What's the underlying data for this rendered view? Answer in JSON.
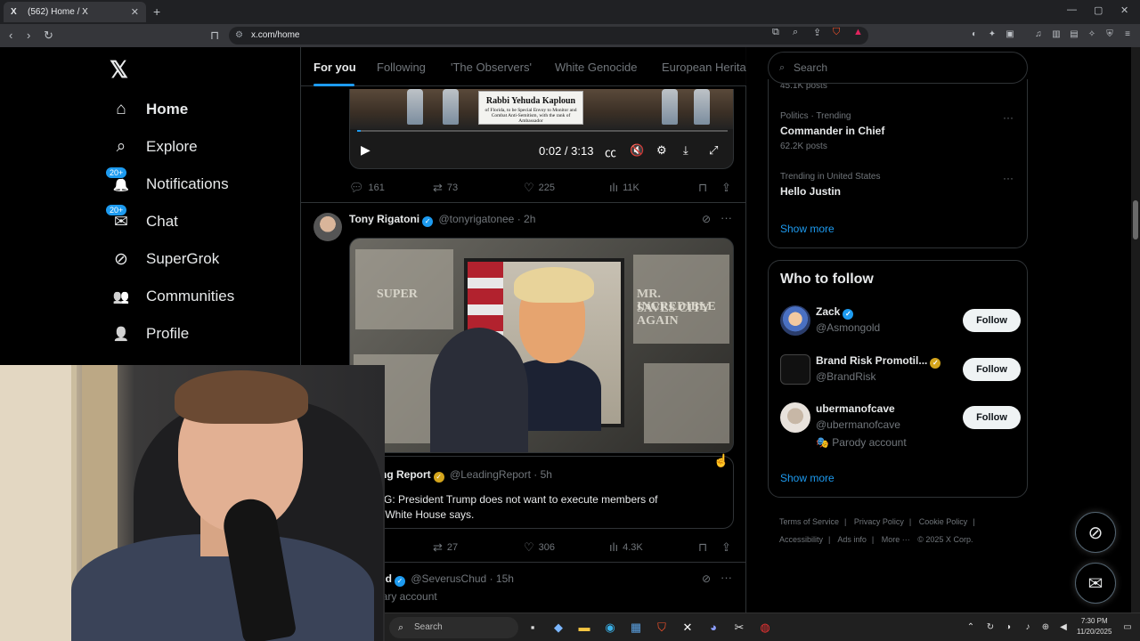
{
  "browser": {
    "tab_title": "(562) Home / X",
    "tab_favicon": "X",
    "close_tab": "✕",
    "new_tab": "+",
    "url": "x.com/home",
    "window_controls": [
      "—",
      "▢",
      "✕"
    ]
  },
  "sidebar": {
    "logo": "𝕏",
    "items": [
      {
        "label": "Home",
        "icon": "home-icon",
        "glyph": "⌂"
      },
      {
        "label": "Explore",
        "icon": "search-icon",
        "glyph": "⌕"
      },
      {
        "label": "Notifications",
        "icon": "bell-icon",
        "glyph": "🔔",
        "badge": "20+"
      },
      {
        "label": "Chat",
        "icon": "mail-icon",
        "glyph": "✉",
        "badge": "20+"
      },
      {
        "label": "SuperGrok",
        "icon": "grok-icon",
        "glyph": "⊘"
      },
      {
        "label": "Communities",
        "icon": "communities-icon",
        "glyph": "👥"
      },
      {
        "label": "Profile",
        "icon": "profile-icon",
        "glyph": "👤"
      }
    ]
  },
  "feed": {
    "tabs": [
      "For you",
      "Following",
      "'The Observers'",
      "White Genocide",
      "European Herita"
    ],
    "video_tweet": {
      "placard_name": "Rabbi Yehuda Kaploun",
      "placard_title": "of Florida, to be Special Envoy to Monitor and Combat Anti-Semitism, with the rank of Ambassador",
      "time": "0:02 / 3:13",
      "progress": 0.01,
      "replies": "161",
      "reposts": "73",
      "likes": "225",
      "views": "11K"
    },
    "tweet2": {
      "name": "Tony Rigatoni",
      "handle": "@tonyrigatonee",
      "time": "· 2h",
      "image_headlines": [
        "MR. INCREDIBLE",
        "SAVES CITY AGAIN",
        "SUPER"
      ],
      "quote": {
        "name": "eading Report",
        "handle": "@LeadingReport",
        "time": "· 5h",
        "text_l1": "AKING: President Trump does not want to execute members of",
        "text_l2": "ress, White House says."
      },
      "reposts": "27",
      "likes": "306",
      "views": "4.3K"
    },
    "tweet3": {
      "name": "us Chud",
      "handle": "@SeverusChud",
      "time": "· 15h",
      "text": "mmentary account"
    }
  },
  "right": {
    "search_placeholder": "Search",
    "trends": [
      {
        "meta": "",
        "topic": "",
        "posts": "45.1K posts"
      },
      {
        "meta": "Politics · Trending",
        "topic": "Commander in Chief",
        "posts": "62.2K posts"
      },
      {
        "meta": "Trending in United States",
        "topic": "Hello Justin",
        "posts": ""
      }
    ],
    "show_more": "Show more",
    "who_to_follow": {
      "title": "Who to follow",
      "users": [
        {
          "name": "Zack",
          "handle": "@Asmongold",
          "verified": "blue",
          "button": "Follow"
        },
        {
          "name": "Brand Risk Promotil...",
          "handle": "@BrandRisk",
          "verified": "gold",
          "button": "Follow"
        },
        {
          "name": "ubermanofcave",
          "handle": "@ubermanofcave",
          "parody": "🎭 Parody account",
          "button": "Follow"
        }
      ],
      "show_more": "Show more"
    },
    "footer": [
      "Terms of Service",
      "|",
      "Privacy Policy",
      "|",
      "Cookie Policy",
      "|",
      "Accessibility",
      "|",
      "Ads info",
      "|",
      "More ···",
      "© 2025 X Corp."
    ]
  },
  "taskbar": {
    "search": "Search",
    "time": "7:30 PM",
    "date": "11/20/2025"
  },
  "colors": {
    "accent": "#1d9bf0",
    "background": "#000000",
    "border": "#2f3336",
    "muted": "#71767b"
  }
}
